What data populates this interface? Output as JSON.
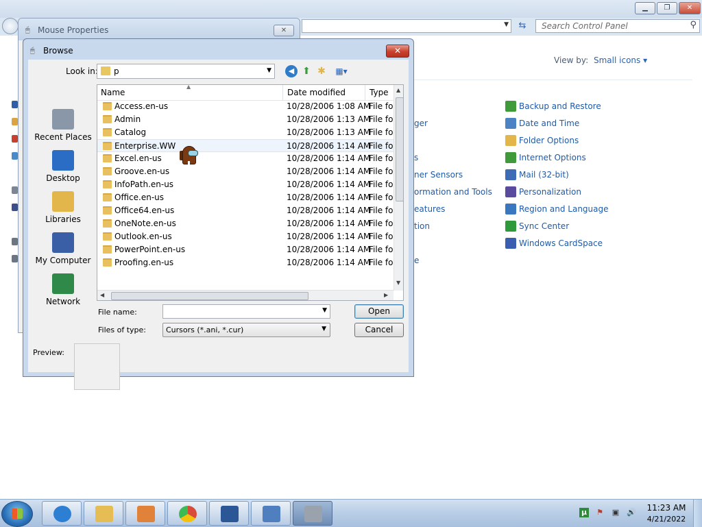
{
  "control_panel": {
    "search_placeholder": "Search Control Panel",
    "view_by_label": "View by:",
    "view_by_value": "Small icons",
    "right_column": [
      {
        "label": "Backup and Restore",
        "icon": "backup-icon",
        "color": "#3f9a3a"
      },
      {
        "label": "Date and Time",
        "icon": "clock-icon",
        "color": "#4c83c4"
      },
      {
        "label": "Folder Options",
        "icon": "folder-icon",
        "color": "#e2b64a"
      },
      {
        "label": "Internet Options",
        "icon": "globe-icon",
        "color": "#3f9a3a"
      },
      {
        "label": "Mail (32-bit)",
        "icon": "mail-icon",
        "color": "#3d6bb5"
      },
      {
        "label": "Personalization",
        "icon": "monitor-icon",
        "color": "#5a4b9e"
      },
      {
        "label": "Region and Language",
        "icon": "globe-icon",
        "color": "#3977c1"
      },
      {
        "label": "Sync Center",
        "icon": "sync-icon",
        "color": "#2f9a3b"
      },
      {
        "label": "Windows CardSpace",
        "icon": "card-icon",
        "color": "#3a5fb0"
      }
    ],
    "middle_column_fragments": [
      "ger",
      "s",
      "ner Sensors",
      "ormation and Tools",
      "eatures",
      "tion",
      "e"
    ]
  },
  "mouse_properties": {
    "title": "Mouse Properties",
    "close_label": "✕"
  },
  "browse": {
    "title": "Browse",
    "close_label": "✕",
    "look_in_label": "Look in:",
    "look_in_value": "p",
    "places": [
      {
        "label": "Recent Places",
        "icon": "recent-places-icon"
      },
      {
        "label": "Desktop",
        "icon": "desktop-icon"
      },
      {
        "label": "Libraries",
        "icon": "libraries-icon"
      },
      {
        "label": "My Computer",
        "icon": "computer-icon"
      },
      {
        "label": "Network",
        "icon": "network-icon"
      }
    ],
    "columns": {
      "name": "Name",
      "date": "Date modified",
      "type": "Type"
    },
    "files": [
      {
        "name": "Access.en-us",
        "date": "10/28/2006 1:08 AM",
        "type": "File fol"
      },
      {
        "name": "Admin",
        "date": "10/28/2006 1:13 AM",
        "type": "File fol"
      },
      {
        "name": "Catalog",
        "date": "10/28/2006 1:13 AM",
        "type": "File fol"
      },
      {
        "name": "Enterprise.WW",
        "date": "10/28/2006 1:14 AM",
        "type": "File fol"
      },
      {
        "name": "Excel.en-us",
        "date": "10/28/2006 1:14 AM",
        "type": "File fol"
      },
      {
        "name": "Groove.en-us",
        "date": "10/28/2006 1:14 AM",
        "type": "File fol"
      },
      {
        "name": "InfoPath.en-us",
        "date": "10/28/2006 1:14 AM",
        "type": "File fol"
      },
      {
        "name": "Office.en-us",
        "date": "10/28/2006 1:14 AM",
        "type": "File fol"
      },
      {
        "name": "Office64.en-us",
        "date": "10/28/2006 1:14 AM",
        "type": "File fol"
      },
      {
        "name": "OneNote.en-us",
        "date": "10/28/2006 1:14 AM",
        "type": "File fol"
      },
      {
        "name": "Outlook.en-us",
        "date": "10/28/2006 1:14 AM",
        "type": "File fol"
      },
      {
        "name": "PowerPoint.en-us",
        "date": "10/28/2006 1:14 AM",
        "type": "File fol"
      },
      {
        "name": "Proofing.en-us",
        "date": "10/28/2006 1:14 AM",
        "type": "File fol"
      }
    ],
    "selected_index": 3,
    "file_name_label": "File name:",
    "file_name_value": "",
    "files_of_type_label": "Files of type:",
    "files_of_type_value": "Cursors (*.ani, *.cur)",
    "open_label": "Open",
    "cancel_label": "Cancel",
    "preview_label": "Preview:"
  },
  "taskbar": {
    "items": [
      {
        "name": "internet-explorer-icon",
        "color": "#2d7fd3"
      },
      {
        "name": "file-explorer-icon",
        "color": "#e5bd54"
      },
      {
        "name": "media-player-icon",
        "color": "#e0823a"
      },
      {
        "name": "chrome-icon",
        "color": "#d94a3b"
      },
      {
        "name": "word-icon",
        "color": "#2b5797"
      },
      {
        "name": "control-panel-icon",
        "color": "#4f7fbf"
      },
      {
        "name": "mouse-icon",
        "color": "#9aa3ad"
      }
    ],
    "clock_time": "11:23 AM",
    "clock_date": "4/21/2022"
  }
}
